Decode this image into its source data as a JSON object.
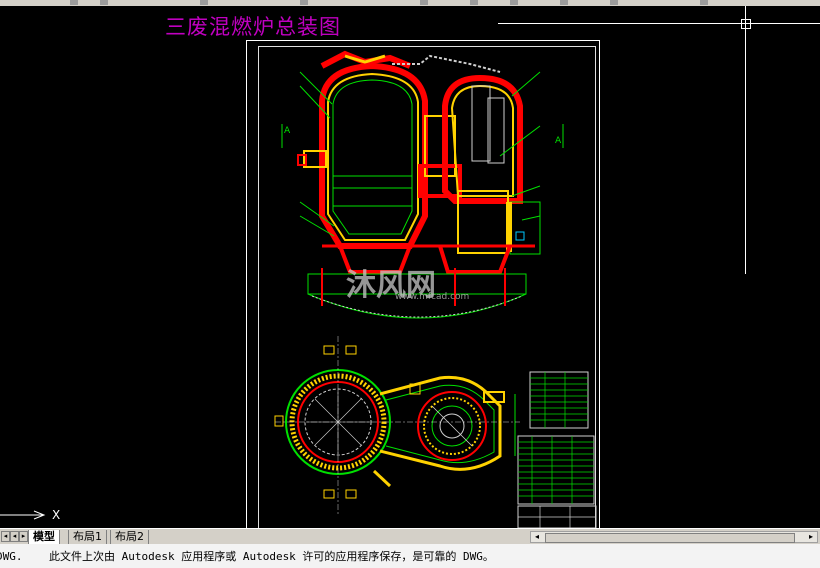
{
  "drawing": {
    "title": "三废混燃炉总装图",
    "section_labels": {
      "left": "A",
      "right": "A"
    },
    "watermark": "沐风网",
    "watermark_url": "www.mfcad.com"
  },
  "ucs_axis_label": "X",
  "layout_tabs": {
    "active": "模型",
    "items": [
      "模型",
      "布局1",
      "布局2"
    ]
  },
  "command_line": {
    "line1": "DWG.    此文件上次由 Autodesk 应用程序或 Autodesk 许可的应用程序保存，是可靠的 DWG。",
    "line2": ""
  },
  "colors": {
    "background": "#000000",
    "title": "#c000c0",
    "refractory": "#ff0000",
    "insulation": "#ffd200",
    "outline": "#00e000",
    "detail": "#00c8ff"
  }
}
